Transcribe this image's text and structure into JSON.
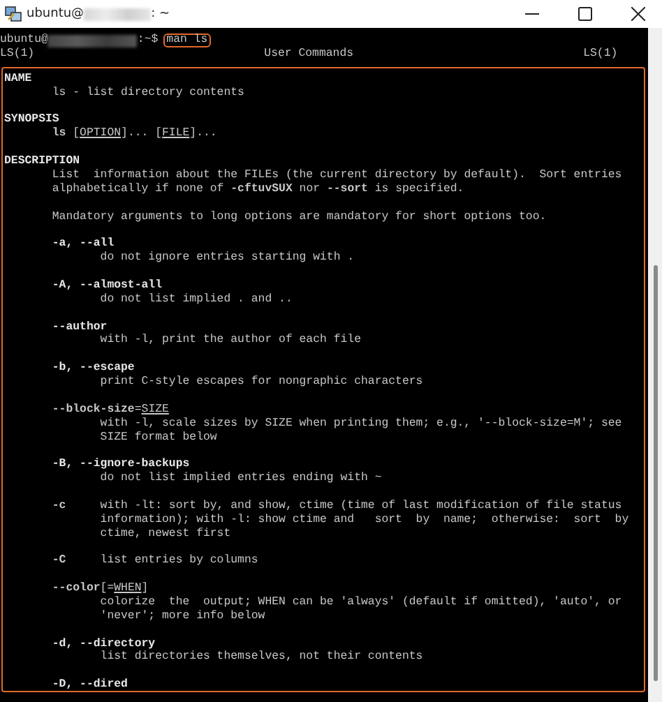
{
  "window": {
    "title_user": "ubuntu@",
    "title_path": ": ~"
  },
  "prompt": {
    "user": "ubuntu@",
    "suffix": ":~$",
    "command": "man ls"
  },
  "header": {
    "left": "LS(1)",
    "center": "User Commands",
    "right": "LS(1)"
  },
  "blocks": [
    [
      {
        "kind": "heading",
        "text": "NAME"
      },
      {
        "kind": "body",
        "text": "ls - list directory contents"
      }
    ],
    [
      {
        "kind": "heading",
        "text": "SYNOPSIS"
      },
      {
        "kind": "body",
        "parts": [
          {
            "text": "**ls** ["
          },
          {
            "text": "OPTION",
            "underlined": true
          },
          {
            "text": "]... ["
          },
          {
            "text": "FILE",
            "underlined": true
          },
          {
            "text": "]..."
          }
        ]
      }
    ],
    [
      {
        "kind": "heading",
        "text": "DESCRIPTION"
      },
      {
        "kind": "body",
        "text": "List  information about the FILEs (the current directory by default).  Sort entries"
      },
      {
        "kind": "body",
        "text": "alphabetically if none of **-cftuvSUX** nor **--sort** is specified."
      }
    ],
    [
      {
        "kind": "body",
        "text": "Mandatory arguments to long options are mandatory for short options too."
      }
    ],
    [
      {
        "kind": "option",
        "text": "-a, --all"
      },
      {
        "kind": "desc",
        "text": "do not ignore entries starting with ."
      }
    ],
    [
      {
        "kind": "option",
        "text": "-A, --almost-all"
      },
      {
        "kind": "desc",
        "text": "do not list implied . and .."
      }
    ],
    [
      {
        "kind": "option",
        "text": "--author"
      },
      {
        "kind": "desc",
        "text": "with -l, print the author of each file"
      }
    ],
    [
      {
        "kind": "option",
        "text": "-b, --escape"
      },
      {
        "kind": "desc",
        "text": "print C-style escapes for nongraphic characters"
      }
    ],
    [
      {
        "kind": "body",
        "parts": [
          {
            "text": "**--block-size**="
          },
          {
            "text": "SIZE",
            "underlined": true
          }
        ]
      },
      {
        "kind": "desc",
        "text": "with -l, scale sizes by SIZE when printing them; e.g., '--block-size=M'; see"
      },
      {
        "kind": "desc",
        "text": "SIZE format below"
      }
    ],
    [
      {
        "kind": "option",
        "text": "-B, --ignore-backups"
      },
      {
        "kind": "desc",
        "text": "do not list implied entries ending with ~"
      }
    ],
    [
      {
        "kind": "body",
        "text": "**-c**     with -lt: sort by, and show, ctime (time of last modification of file status"
      },
      {
        "kind": "desc",
        "text": "information); with -l: show ctime and   sort  by  name;  otherwise:  sort  by"
      },
      {
        "kind": "desc",
        "text": "ctime, newest first"
      }
    ],
    [
      {
        "kind": "body",
        "text": "**-C**     list entries by columns"
      }
    ],
    [
      {
        "kind": "body",
        "parts": [
          {
            "text": "**--color**[="
          },
          {
            "text": "WHEN",
            "underlined": true
          },
          {
            "text": "]"
          }
        ]
      },
      {
        "kind": "desc",
        "text": "colorize  the  output; WHEN can be 'always' (default if omitted), 'auto', or"
      },
      {
        "kind": "desc",
        "text": "'never'; more info below"
      }
    ],
    [
      {
        "kind": "option",
        "text": "-d, --directory"
      },
      {
        "kind": "desc",
        "text": "list directories themselves, not their contents"
      }
    ],
    [
      {
        "kind": "option",
        "text": "-D, --dired"
      }
    ]
  ]
}
